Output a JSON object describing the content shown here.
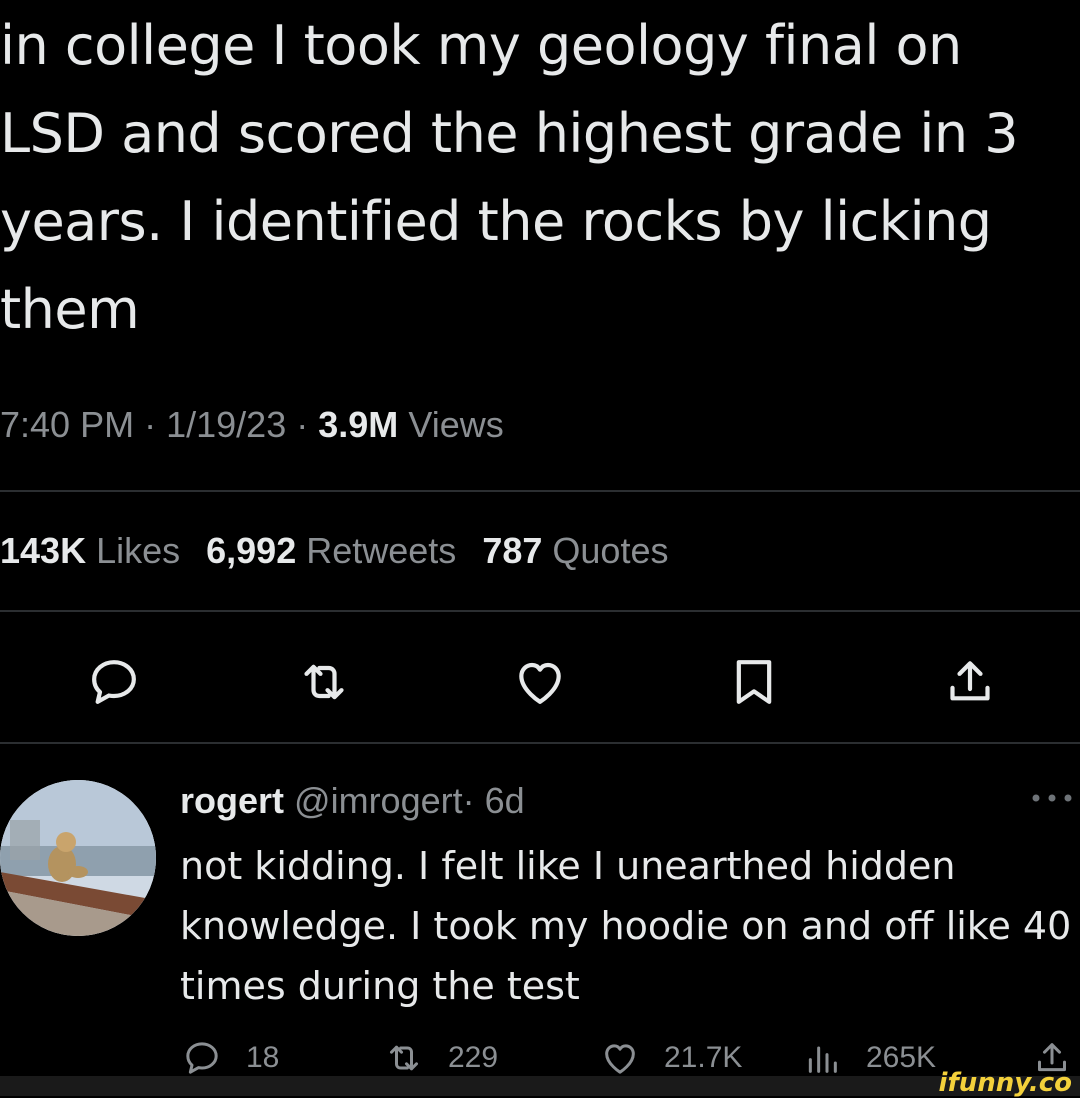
{
  "tweet": {
    "text": "in college I took my geology final on LSD and scored the highest grade in 3 years. I identified the rocks by licking them",
    "time": "7:40 PM",
    "date": "1/19/23",
    "views_count": "3.9M",
    "views_label": "Views",
    "separator": "·"
  },
  "stats": {
    "likes_count": "143K",
    "likes_label": "Likes",
    "retweets_count": "6,992",
    "retweets_label": "Retweets",
    "quotes_count": "787",
    "quotes_label": "Quotes"
  },
  "actions": {
    "icons": [
      "reply-icon",
      "retweet-icon",
      "like-icon",
      "bookmark-icon",
      "share-icon"
    ]
  },
  "reply": {
    "name": "rogert",
    "handle": "@imrogert",
    "age": "· 6d",
    "text": "not kidding. I felt like I unearthed hidden knowledge. I took my hoodie on and off like 40 times during the test",
    "replies": "18",
    "retweets": "229",
    "likes": "21.7K",
    "views": "265K"
  },
  "watermark": "ifunny.co",
  "colors": {
    "background": "#000000",
    "text": "#e7e9ea",
    "muted": "#8b8f93",
    "divider": "#2b2e31",
    "watermark": "#f4d13b"
  }
}
